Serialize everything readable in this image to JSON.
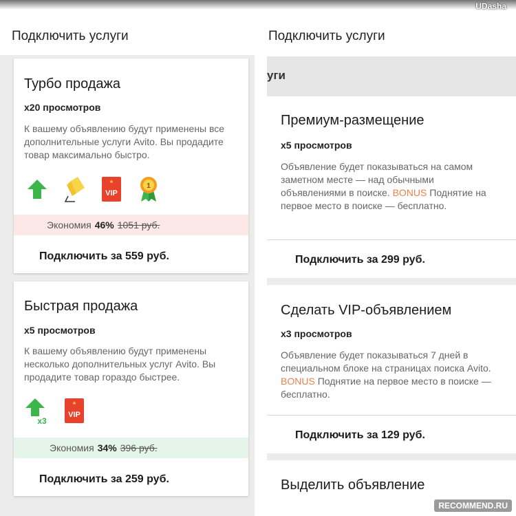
{
  "status_bar": {
    "username": "UDasha"
  },
  "left": {
    "page_title": "Подключить услуги",
    "cards": [
      {
        "title": "Турбо продажа",
        "views": "x20 просмотров",
        "desc": "К вашему объявлению будут применены все дополнительные услуги Avito. Вы продадите товар максимально быстро.",
        "icons": [
          "up-arrow-icon",
          "highlight-icon",
          "vip-icon",
          "medal-icon"
        ],
        "saving_label": "Экономия",
        "saving_pct": "46%",
        "saving_old": "1051 руб.",
        "saving_color": "#fde8e8",
        "buy_label": "Подключить за 559 руб."
      },
      {
        "title": "Быстрая продажа",
        "views": "x5 просмотров",
        "desc": "К вашему объявлению будут применены несколько дополнительных услуг Avito. Вы продадите товар гораздо быстрее.",
        "icons": [
          "up-arrow-x3-icon",
          "vip-icon"
        ],
        "icon_badge": "x3",
        "saving_label": "Экономия",
        "saving_pct": "34%",
        "saving_old": "396 руб.",
        "saving_color": "#e5f5ea",
        "buy_label": "Подключить за 259 руб."
      }
    ]
  },
  "right": {
    "page_title": "Подключить услуги",
    "band_text": "уги",
    "bonus_word": "BONUS",
    "items": [
      {
        "title": "Премиум-размещение",
        "views": "x5 просмотров",
        "desc_before": "Объявление будет показываться на самом заметном месте — над обычными объявлениями в поиске.",
        "desc_after": "Поднятие на первое место в поиске — бесплатно.",
        "buy_label": "Подключить за 299 руб."
      },
      {
        "title": "Сделать VIP-объявлением",
        "views": "x3 просмотров",
        "desc_before": "Объявление будет показываться 7 дней в специальном блоке на страницах поиска Avito.",
        "desc_after": "Поднятие на первое место в поиске — бесплатно.",
        "buy_label": "Подключить за 129 руб."
      },
      {
        "title": "Выделить объявление"
      }
    ]
  },
  "vip_text": "VIP",
  "medal_text": "1",
  "watermark": "RECOMMEND.RU",
  "colors": {
    "green": "#3cb54a",
    "red_vip": "#e8412c",
    "yellow": "#f7d54a",
    "bonus": "#e8804c"
  }
}
